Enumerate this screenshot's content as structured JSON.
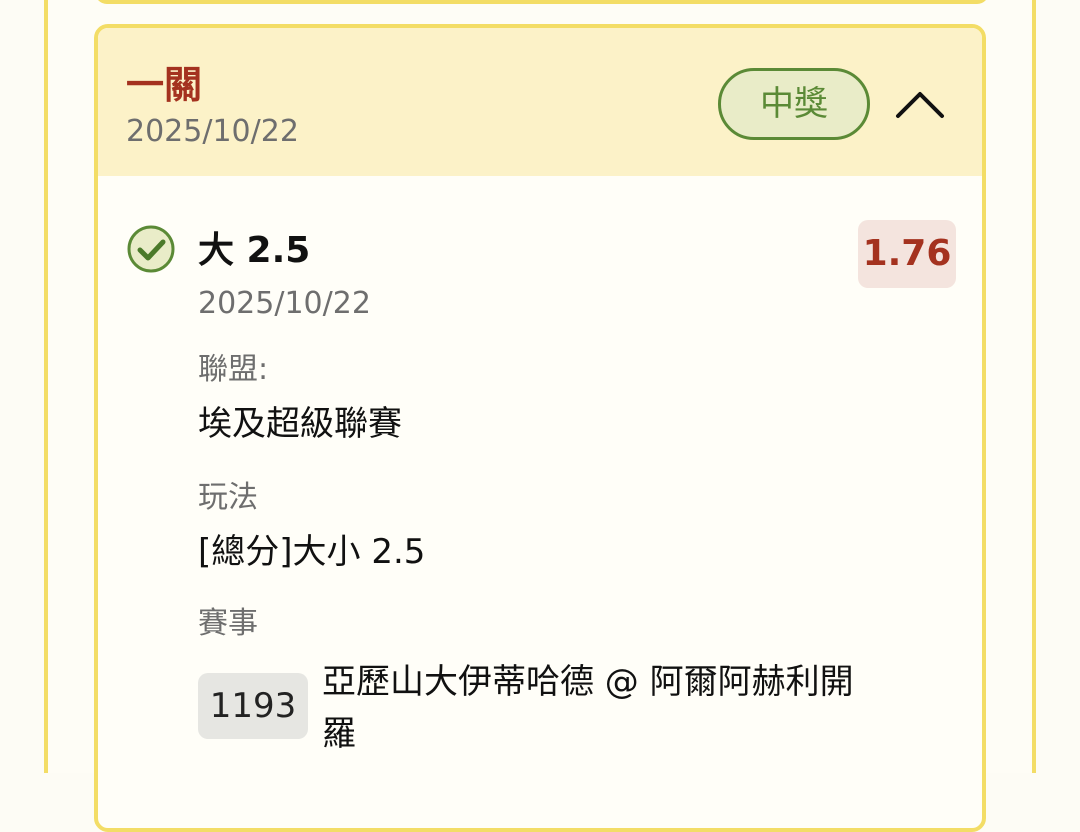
{
  "bet": {
    "type_label": "一關",
    "date": "2025/10/22",
    "status_label": "中獎"
  },
  "selection": {
    "name": "大 2.5",
    "date": "2025/10/22",
    "odds": "1.76",
    "status": "won"
  },
  "league": {
    "label": "聯盟:",
    "value": "埃及超級聯賽"
  },
  "market": {
    "label": "玩法",
    "value": "[總分]大小 2.5"
  },
  "match": {
    "label": "賽事",
    "number": "1193",
    "name": "亞歷山大伊蒂哈德 @ 阿爾阿赫利開羅"
  },
  "icons": {
    "status_icon": "check-circle-icon",
    "toggle_icon": "chevron-up-icon"
  },
  "colors": {
    "accent_red": "#a4321f",
    "win_green": "#5b8a36",
    "card_border": "#f3dd66",
    "header_bg": "#fcf2c8"
  }
}
